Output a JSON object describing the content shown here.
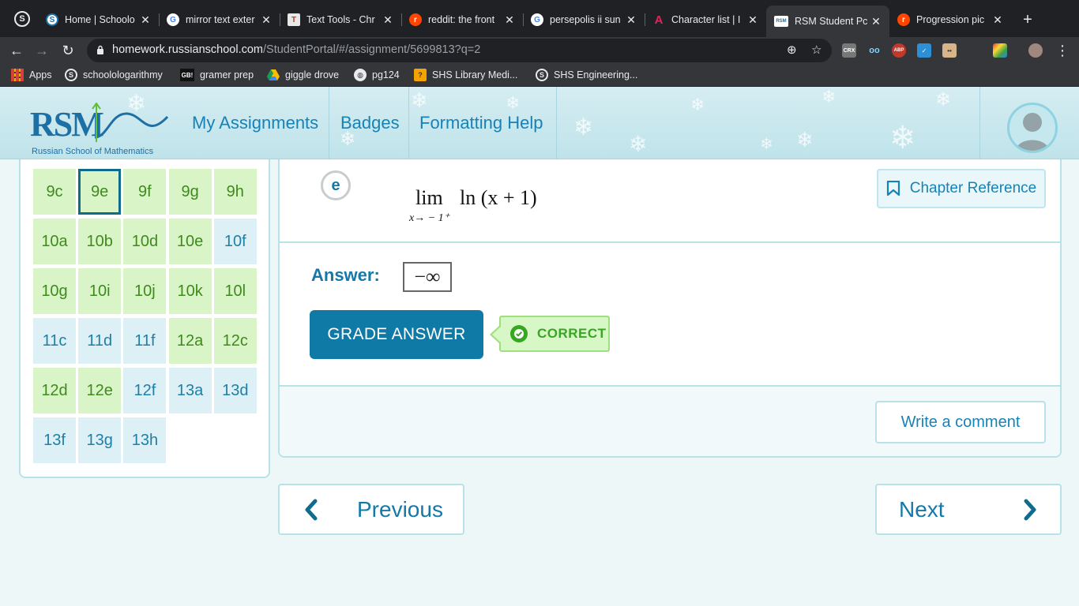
{
  "browser": {
    "tabs": [
      {
        "title": "Home | Schoolo",
        "favicon": "S"
      },
      {
        "title": "mirror text exter",
        "favicon": "G"
      },
      {
        "title": "Text Tools - Chr",
        "favicon": "T"
      },
      {
        "title": "reddit: the front",
        "favicon": "r"
      },
      {
        "title": "persepolis ii sun",
        "favicon": "G"
      },
      {
        "title": "Character list | I",
        "favicon": "A"
      },
      {
        "title": "RSM Student Pc",
        "favicon": "RSM"
      },
      {
        "title": "Progression pic",
        "favicon": "r"
      }
    ],
    "url_host": "homework.russianschool.com",
    "url_path": "/StudentPortal/#/assignment/5699813?q=2",
    "bookmarks": [
      {
        "label": "Apps"
      },
      {
        "label": "schoolologarithmy"
      },
      {
        "label": "gramer prep"
      },
      {
        "label": "giggle drove"
      },
      {
        "label": "pg124"
      },
      {
        "label": "SHS Library Medi..."
      },
      {
        "label": "SHS Engineering..."
      }
    ],
    "extensions": [
      "CRX",
      "ABP"
    ],
    "bookmark_icons": {
      "gramer_prep": "GB!"
    }
  },
  "site": {
    "logo_text": "RSM",
    "logo_subtitle": "Russian School of Mathematics",
    "nav": [
      "My Assignments",
      "Badges",
      "Formatting Help"
    ]
  },
  "problems": [
    {
      "label": "9c",
      "status": "correct"
    },
    {
      "label": "9e",
      "status": "correct",
      "selected": true
    },
    {
      "label": "9f",
      "status": "correct"
    },
    {
      "label": "9g",
      "status": "correct"
    },
    {
      "label": "9h",
      "status": "correct"
    },
    {
      "label": "10a",
      "status": "correct"
    },
    {
      "label": "10b",
      "status": "correct"
    },
    {
      "label": "10d",
      "status": "correct"
    },
    {
      "label": "10e",
      "status": "correct"
    },
    {
      "label": "10f",
      "status": "open"
    },
    {
      "label": "10g",
      "status": "correct"
    },
    {
      "label": "10i",
      "status": "correct"
    },
    {
      "label": "10j",
      "status": "correct"
    },
    {
      "label": "10k",
      "status": "correct"
    },
    {
      "label": "10l",
      "status": "correct"
    },
    {
      "label": "11c",
      "status": "open"
    },
    {
      "label": "11d",
      "status": "open"
    },
    {
      "label": "11f",
      "status": "open"
    },
    {
      "label": "12a",
      "status": "correct"
    },
    {
      "label": "12c",
      "status": "correct"
    },
    {
      "label": "12d",
      "status": "correct"
    },
    {
      "label": "12e",
      "status": "correct"
    },
    {
      "label": "12f",
      "status": "open"
    },
    {
      "label": "13a",
      "status": "open"
    },
    {
      "label": "13d",
      "status": "open"
    },
    {
      "label": "13f",
      "status": "open"
    },
    {
      "label": "13g",
      "status": "open"
    },
    {
      "label": "13h",
      "status": "open"
    }
  ],
  "question": {
    "letter": "e",
    "formula_lim": "lim",
    "formula_sub": "x→ − 1⁺",
    "formula_rest": "ln (x + 1)",
    "chapter_reference": "Chapter Reference",
    "answer_label": "Answer:",
    "answer_value": "−∞",
    "grade_button": "GRADE ANSWER",
    "result": "CORRECT",
    "comment_button": "Write a comment"
  },
  "pager": {
    "previous": "Previous",
    "next": "Next"
  },
  "colors": {
    "accent": "#0f7aa6",
    "correct": "#37a620",
    "correct_bg": "#d9f5c8",
    "open_bg": "#dcf0f6"
  }
}
